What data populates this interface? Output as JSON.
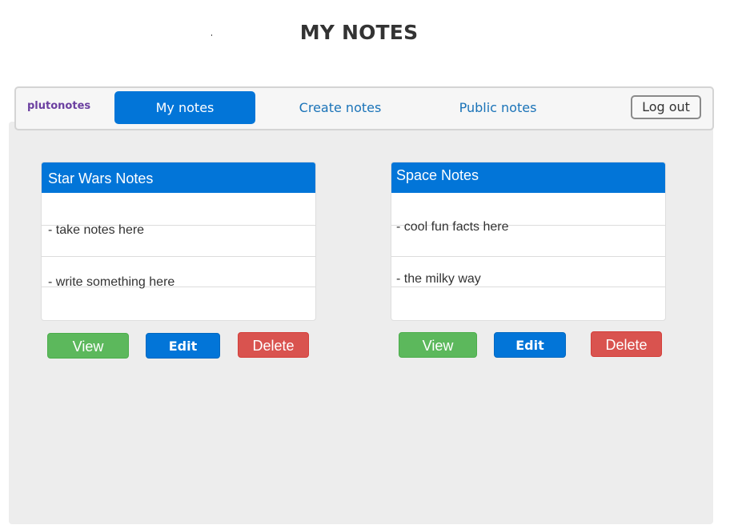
{
  "page": {
    "title": "MY NOTES"
  },
  "navbar": {
    "brand": "plutonotes",
    "items": [
      {
        "label": "My notes",
        "active": true
      },
      {
        "label": "Create notes",
        "active": false
      },
      {
        "label": "Public notes",
        "active": false
      }
    ],
    "logout_label": "Log out"
  },
  "notes": [
    {
      "title": "Star Wars Notes",
      "lines": [
        "- take notes here",
        "- write something here"
      ],
      "actions": {
        "view": "View",
        "edit": "Edit",
        "delete": "Delete"
      }
    },
    {
      "title": "Space Notes",
      "lines": [
        "- cool fun facts here",
        "- the milky way"
      ],
      "actions": {
        "view": "View",
        "edit": "Edit",
        "delete": "Delete"
      }
    }
  ],
  "colors": {
    "primary": "#0275d8",
    "success": "#5cb85c",
    "danger": "#d9534f",
    "brand": "#6b3fa0",
    "panel_bg": "#ededed"
  }
}
